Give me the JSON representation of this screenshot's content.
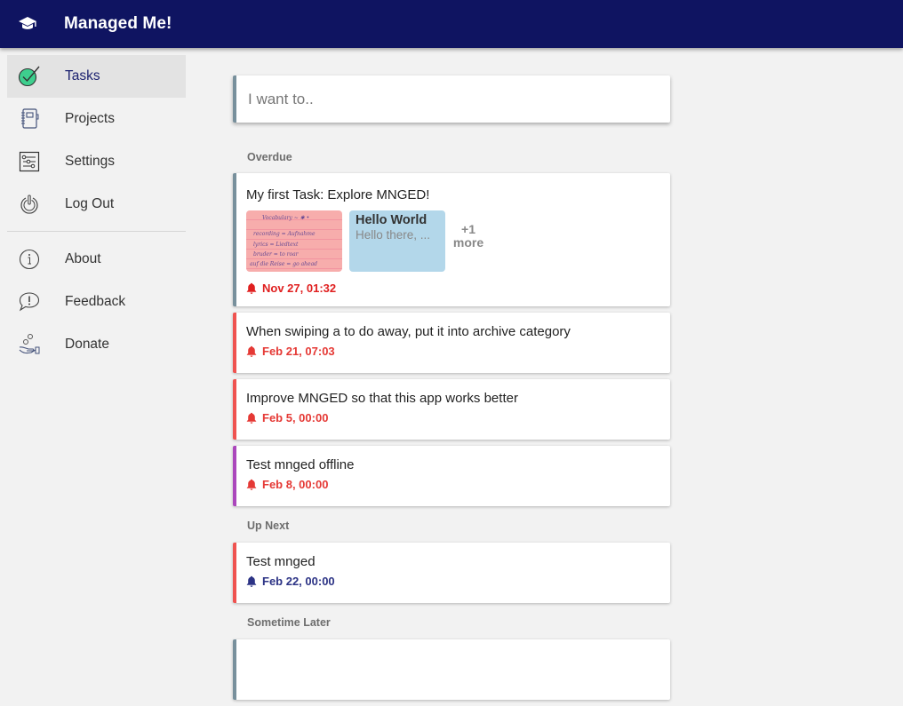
{
  "app": {
    "title": "Managed Me!",
    "logo_icon": "graduation-cap-icon",
    "colors": {
      "appbar": "#0f1461",
      "overdue": "#e53935",
      "upcoming": "#2c3385",
      "accent_green": "#3ecf8e"
    }
  },
  "sidebar": {
    "items": [
      {
        "label": "Tasks",
        "icon": "check-circle-icon",
        "active": true
      },
      {
        "label": "Projects",
        "icon": "notebook-icon",
        "active": false
      },
      {
        "label": "Settings",
        "icon": "sliders-icon",
        "active": false
      },
      {
        "label": "Log Out",
        "icon": "power-icon",
        "active": false
      }
    ],
    "secondary_items": [
      {
        "label": "About",
        "icon": "info-icon"
      },
      {
        "label": "Feedback",
        "icon": "feedback-icon"
      },
      {
        "label": "Donate",
        "icon": "donate-icon"
      }
    ]
  },
  "search": {
    "placeholder": "I want to..",
    "value": ""
  },
  "sections": [
    {
      "label": "Overdue",
      "tasks": [
        {
          "title": "My first Task: Explore MNGED!",
          "color": "#78909c",
          "attachments": {
            "image": {
              "lines": [
                "Vocabulary ~ ✱ •",
                "recording  = Aufnahme",
                "lyrics  = Liedtext",
                "bruder  = to roar",
                "auf die Reise  = go ahead"
              ]
            },
            "note": {
              "title": "Hello World",
              "body": "Hello there, ..."
            },
            "more_count": "+1",
            "more_label": "more"
          },
          "reminder": "Nov 27, 01:32",
          "reminder_color": "#e02020"
        },
        {
          "title": "When swiping a to do away, put it into archive category",
          "color": "#ef5350",
          "reminder": "Feb 21, 07:03",
          "reminder_color": "#e53935"
        },
        {
          "title": "Improve MNGED so that this app works better",
          "color": "#ef5350",
          "reminder": "Feb 5, 00:00",
          "reminder_color": "#e53935"
        },
        {
          "title": "Test mnged offline",
          "color": "#ab47bc",
          "reminder": "Feb 8, 00:00",
          "reminder_color": "#e53935"
        }
      ]
    },
    {
      "label": "Up Next",
      "tasks": [
        {
          "title": "Test mnged",
          "color": "#ef5350",
          "reminder": "Feb 22, 00:00",
          "reminder_color": "#2c3385"
        }
      ]
    },
    {
      "label": "Sometime Later",
      "tasks": [
        {
          "title": "",
          "color": "#78909c"
        }
      ]
    }
  ]
}
